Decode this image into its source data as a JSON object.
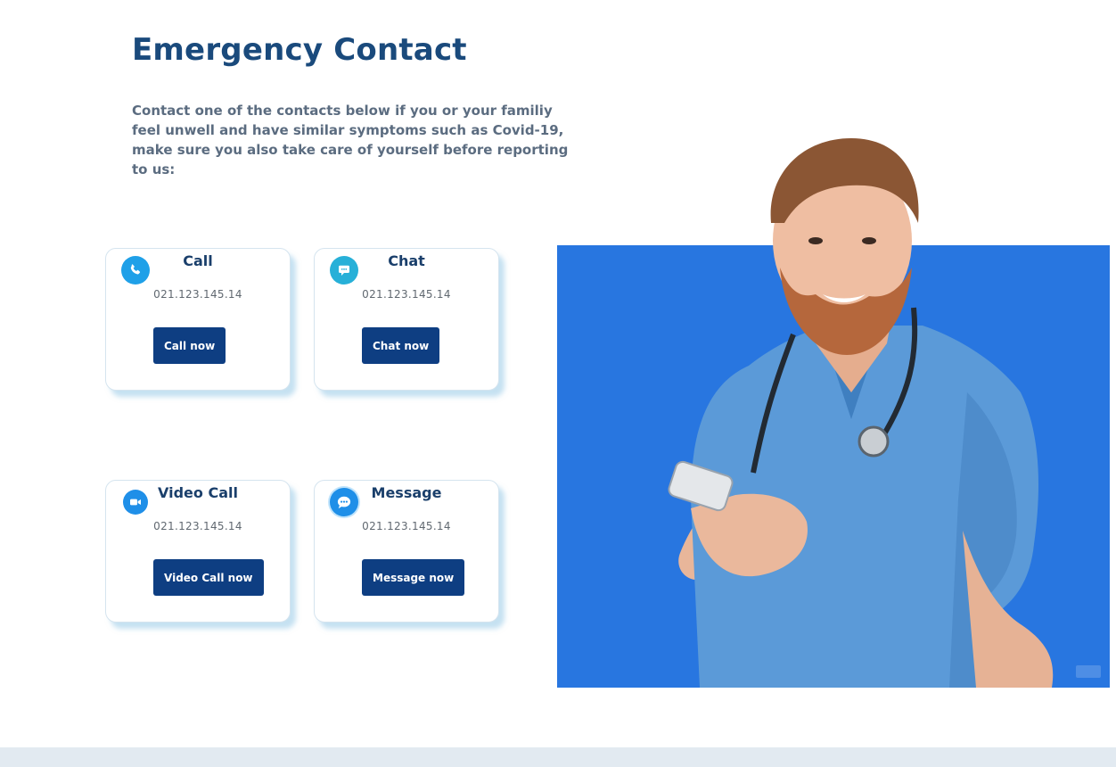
{
  "page": {
    "title": "Emergency Contact",
    "intro": "Contact one of the contacts below if you or your familiy feel unwell and have similar symptoms such as Covid-19, make sure you also take care of yourself before reporting to us:"
  },
  "cards": [
    {
      "title": "Call",
      "phone": "021.123.145.14",
      "button": "Call now",
      "icon": "phone-icon"
    },
    {
      "title": "Chat",
      "phone": "021.123.145.14",
      "button": "Chat now",
      "icon": "chat-icon"
    },
    {
      "title": "Video Call",
      "phone": "021.123.145.14",
      "button": "Video Call now",
      "icon": "video-camera-icon"
    },
    {
      "title": "Message",
      "phone": "021.123.145.14",
      "button": "Message now",
      "icon": "message-bubble-icon"
    }
  ],
  "colors": {
    "title": "#1a4a7c",
    "button": "#0e3e82",
    "hero_background": "#2876e0",
    "icon_blue": "#1fa0e8",
    "footer_band": "#e2eaf1"
  }
}
